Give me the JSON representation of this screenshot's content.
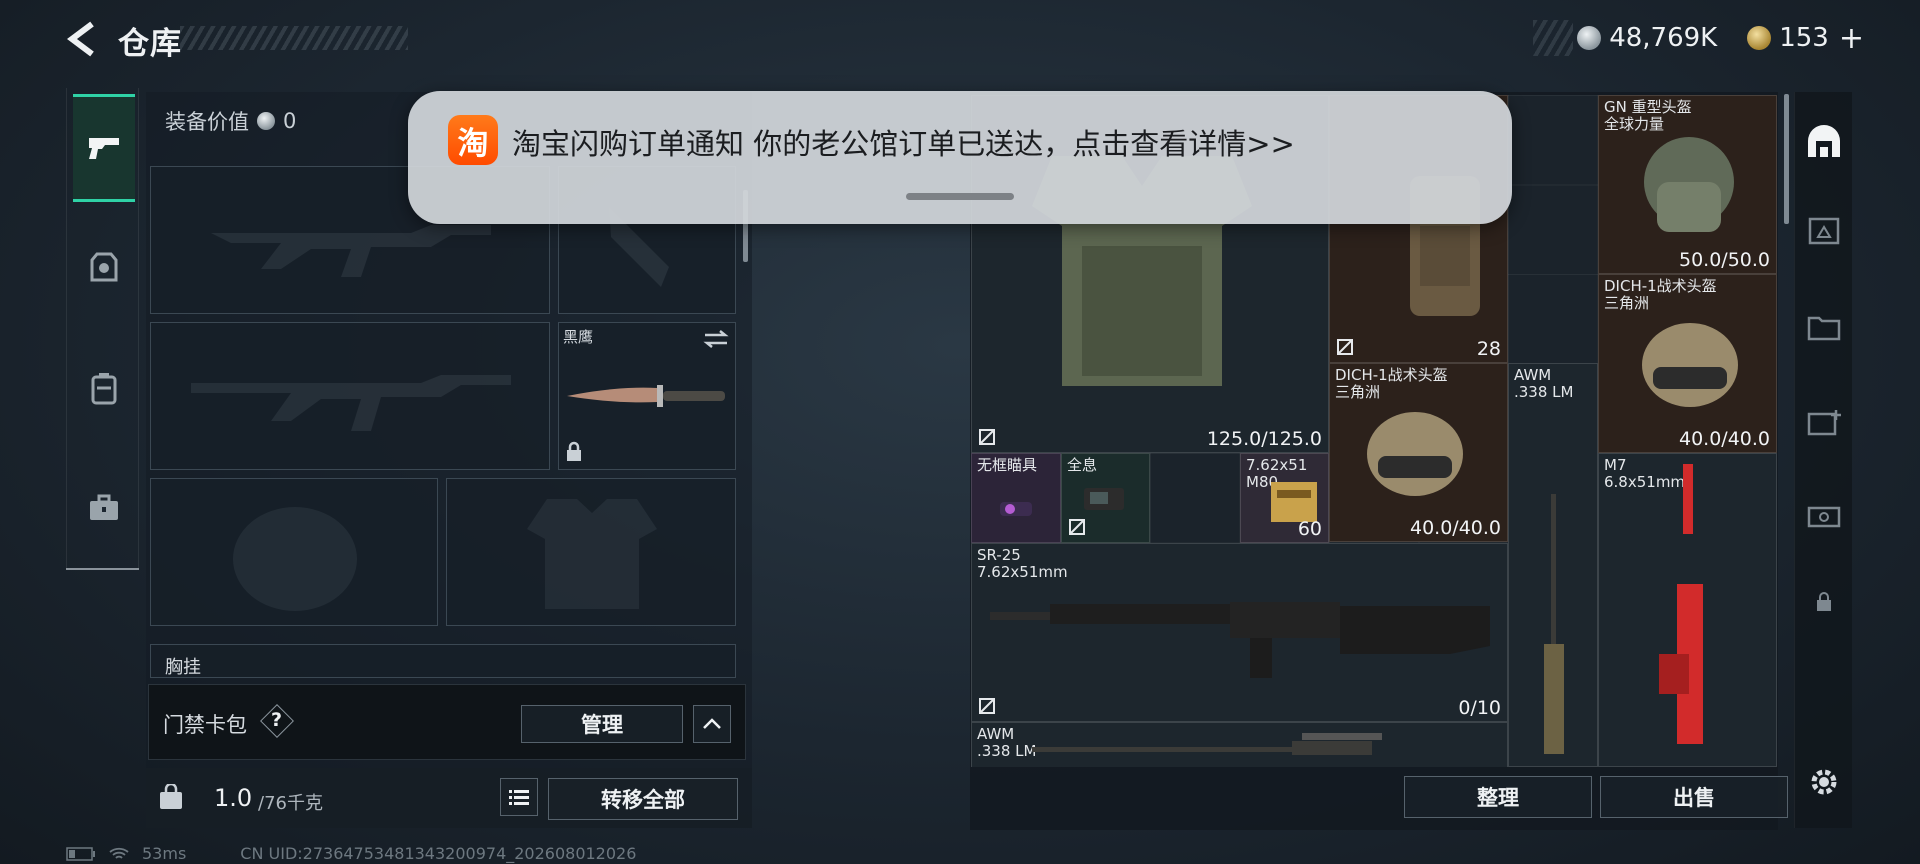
{
  "header": {
    "title": "仓库",
    "currency_silver": "48,769K",
    "currency_gold": "153",
    "plus": "+"
  },
  "equipment": {
    "value_label": "装备价值",
    "value": "0",
    "knife_slot_label": "黑鹰",
    "chest_rig_label": "胸挂",
    "keycard_label": "门禁卡包",
    "help": "?",
    "manage_label": "管理",
    "weight_current": "1.0",
    "weight_max": "/76千克",
    "transfer_all_label": "转移全部"
  },
  "notification": {
    "app_glyph": "淘",
    "text": "淘宝闪购订单通知 你的老公馆订单已送达，点击查看详情>>"
  },
  "storage": {
    "items": [
      {
        "name": "",
        "value": "125.0/125.0"
      },
      {
        "name": "",
        "value": "28"
      },
      {
        "name": "GN 重型头盔\n全球力量",
        "value": "50.0/50.0"
      },
      {
        "name": "DICH-1战术头盔\n三角洲",
        "value": "40.0/40.0"
      },
      {
        "name": "DICH-1战术头盔\n三角洲",
        "value": "40.0/40.0"
      },
      {
        "name": "AWM\n.338 LM",
        "value": ""
      },
      {
        "name": "无框瞄具",
        "value": ""
      },
      {
        "name": "全息",
        "value": ""
      },
      {
        "name": "7.62x51\nM80",
        "value": "60"
      },
      {
        "name": "M7\n6.8x51mm",
        "value": ""
      },
      {
        "name": "SR-25\n7.62x51mm",
        "value": "0/10"
      },
      {
        "name": "AWM\n.338 LM",
        "value": ""
      }
    ],
    "sort_label": "整理",
    "sell_label": "出售"
  },
  "status": {
    "ping": "53ms",
    "uid": "CN UID:2736475348134320097​4_202608012026"
  }
}
